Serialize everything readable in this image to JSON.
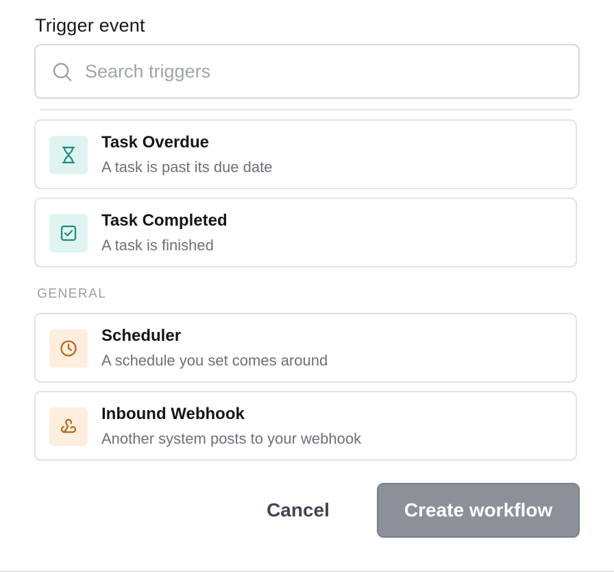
{
  "section": {
    "title": "Trigger event"
  },
  "search": {
    "placeholder": "Search triggers",
    "icon": "search-icon"
  },
  "triggers_top": [
    {
      "title": "Task Overdue",
      "description": "A task is past its due date",
      "icon": "hourglass-icon",
      "tint": "#dff4f1",
      "icon_color": "#1c8a7e"
    },
    {
      "title": "Task Completed",
      "description": "A task is finished",
      "icon": "check-square-icon",
      "tint": "#dff4f1",
      "icon_color": "#1c8a7e"
    }
  ],
  "general": {
    "label": "GENERAL",
    "items": [
      {
        "title": "Scheduler",
        "description": "A schedule you set comes around",
        "icon": "clock-icon",
        "tint": "#fdeedd",
        "icon_color": "#b9641f"
      },
      {
        "title": "Inbound Webhook",
        "description": "Another system posts to your webhook",
        "icon": "webhook-icon",
        "tint": "#fdeedd",
        "icon_color": "#b9641f"
      }
    ]
  },
  "footer": {
    "cancel_label": "Cancel",
    "create_label": "Create workflow"
  }
}
